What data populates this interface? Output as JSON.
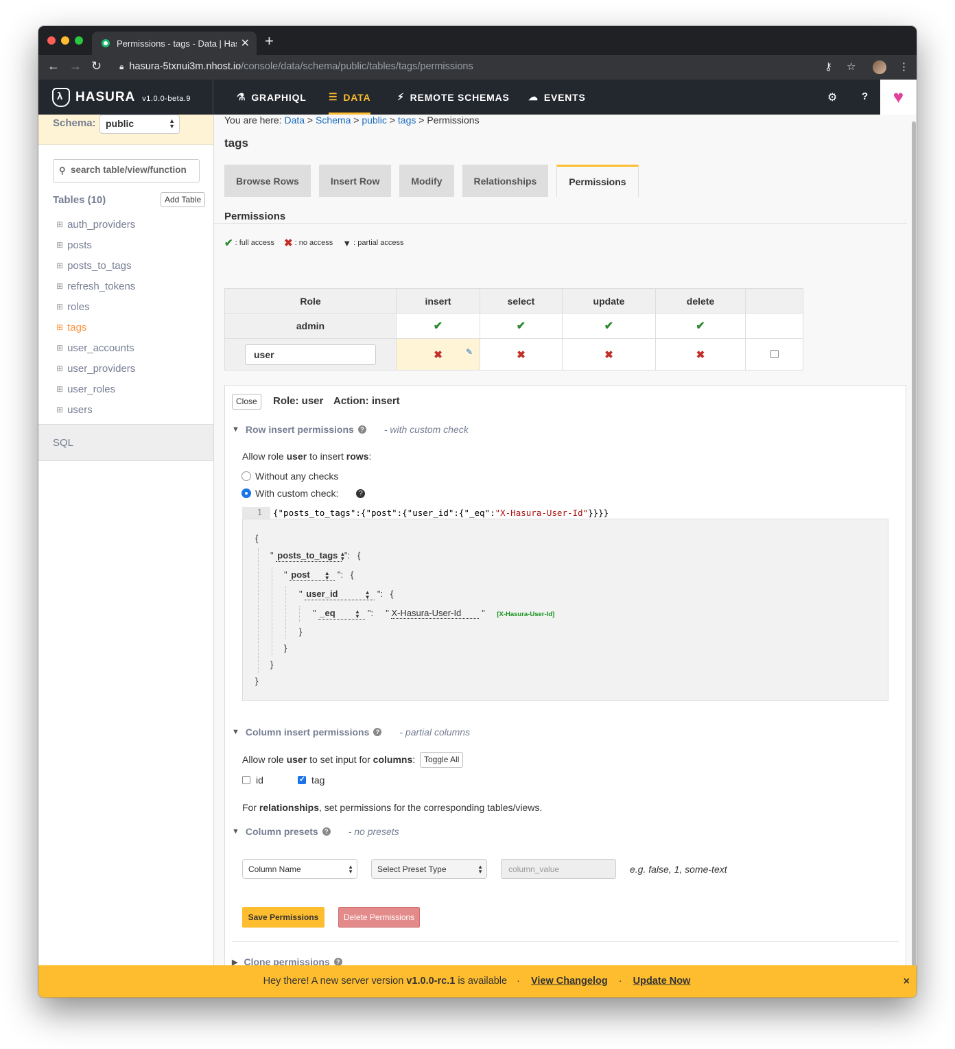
{
  "browser": {
    "tab_title": "Permissions - tags - Data | Has",
    "url_host": "hasura-5txnui3m.nhost.io",
    "url_path": "/console/data/schema/public/tables/tags/permissions"
  },
  "header": {
    "logo_text": "HASURA",
    "version": "v1.0.0-beta.9",
    "nav": [
      {
        "label": "GRAPHIQL",
        "icon": "flask-icon"
      },
      {
        "label": "DATA",
        "icon": "database-icon"
      },
      {
        "label": "REMOTE SCHEMAS",
        "icon": "plug-icon"
      },
      {
        "label": "EVENTS",
        "icon": "cloud-icon"
      }
    ],
    "help": "?"
  },
  "sidebar": {
    "schema_label": "Schema:",
    "schema_value": "public",
    "search_placeholder": "search table/view/function",
    "tables_title": "Tables (10)",
    "add_table": "Add Table",
    "tables": [
      "auth_providers",
      "posts",
      "posts_to_tags",
      "refresh_tokens",
      "roles",
      "tags",
      "user_accounts",
      "user_providers",
      "user_roles",
      "users"
    ],
    "active_table": "tags",
    "sql": "SQL"
  },
  "main": {
    "breadcrumb": {
      "prefix": "You are here:",
      "items": [
        "Data",
        "Schema",
        "public",
        "tags"
      ],
      "current": "Permissions",
      "sep": ">"
    },
    "title": "tags",
    "tabs": [
      "Browse Rows",
      "Insert Row",
      "Modify",
      "Relationships",
      "Permissions"
    ],
    "active_tab": "Permissions",
    "permissions_title": "Permissions",
    "legend": {
      "full": ": full access",
      "none": ": no access",
      "partial": ": partial access"
    },
    "table": {
      "headers": [
        "Role",
        "insert",
        "select",
        "update",
        "delete"
      ],
      "admin_role": "admin",
      "user_role": "user"
    }
  },
  "panel": {
    "close": "Close",
    "role": "Role: user",
    "action": "Action: insert",
    "row_section": {
      "title": "Row insert permissions",
      "sub": "- with custom check"
    },
    "allow_text": {
      "a": "Allow role",
      "role": "user",
      "b": "to insert",
      "c": "rows",
      "d": ":"
    },
    "radio_without": "Without any checks",
    "radio_with": "With custom check:",
    "code_line_no": "1",
    "code": {
      "p1": "{\"posts_to_tags\":{\"post\":{\"user_id\":{\"_eq\":",
      "p2": "\"X-Hasura-User-Id\"",
      "p3": "}}}}"
    },
    "json": {
      "open": "{",
      "close": "}",
      "q": "\"",
      "colon": ":",
      "k1": "posts_to_tags",
      "k2": "post",
      "k3": "user_id",
      "k4": "_eq",
      "value": "X-Hasura-User-Id",
      "tag": "[X-Hasura-User-Id]"
    },
    "column_section": {
      "title": "Column insert permissions",
      "sub": "- partial columns"
    },
    "columns_text": {
      "a": "Allow role",
      "role": "user",
      "b": "to set input for",
      "c": "columns",
      "d": ":"
    },
    "toggle_all": "Toggle All",
    "columns": [
      {
        "name": "id",
        "checked": false
      },
      {
        "name": "tag",
        "checked": true
      }
    ],
    "rel_text": {
      "a": "For",
      "b": "relationships",
      "c": ", set permissions for the corresponding tables/views."
    },
    "presets_section": {
      "title": "Column presets",
      "sub": "- no presets"
    },
    "preset_column": "Column Name",
    "preset_type": "Select Preset Type",
    "preset_value_placeholder": "column_value",
    "preset_example": "e.g. false, 1, some-text",
    "save": "Save Permissions",
    "delete": "Delete Permissions",
    "clone": "Clone permissions"
  },
  "banner": {
    "a": "Hey there! A new server version",
    "version": "v1.0.0-rc.1",
    "b": "is available",
    "changelog": "View Changelog",
    "update": "Update Now",
    "close": "×"
  }
}
